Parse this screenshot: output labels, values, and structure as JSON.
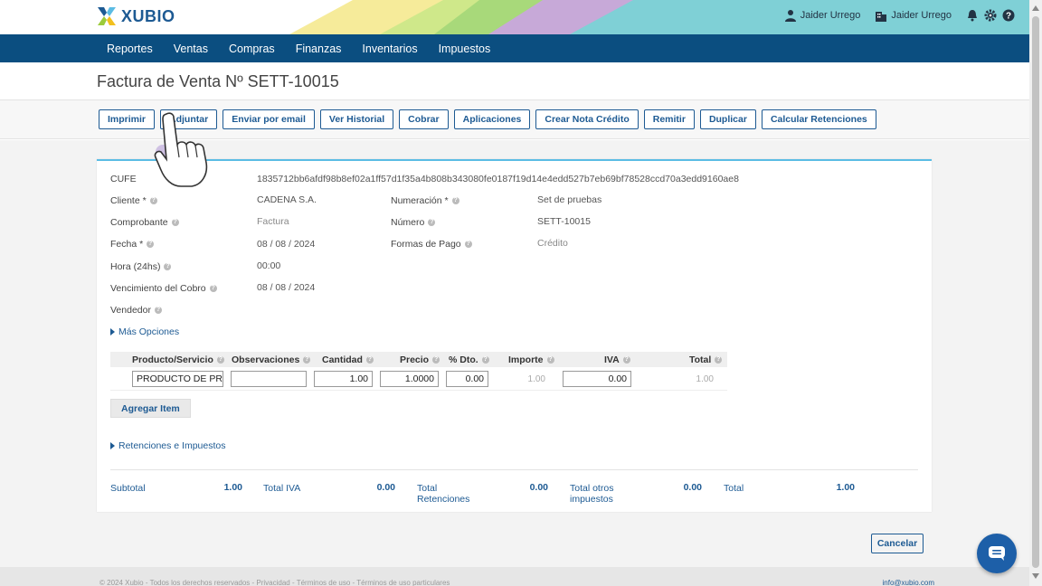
{
  "app": {
    "logo_text": "XUBIO"
  },
  "user": {
    "name": "Jaider Urrego",
    "company": "Jaider Urrego"
  },
  "nav": {
    "items": [
      "Reportes",
      "Ventas",
      "Compras",
      "Finanzas",
      "Inventarios",
      "Impuestos"
    ]
  },
  "page": {
    "title": "Factura de Venta Nº SETT-10015"
  },
  "toolbar": {
    "buttons": [
      "Imprimir",
      "Adjuntar",
      "Enviar por email",
      "Ver Historial",
      "Cobrar",
      "Aplicaciones",
      "Crear Nota Crédito",
      "Remitir",
      "Duplicar",
      "Calcular Retenciones"
    ]
  },
  "form": {
    "cufe_label": "CUFE",
    "cufe_value": "1835712bb6afdf98b8ef02a1ff57d1f35a4b808b343080fe0187f19d14e4edd527b7eb69bf78528ccd70a3edd9160ae8",
    "cliente_label": "Cliente *",
    "cliente_value": "CADENA S.A.",
    "comprobante_label": "Comprobante",
    "comprobante_value": "Factura",
    "fecha_label": "Fecha *",
    "fecha_value": "08 / 08 / 2024",
    "hora_label": "Hora (24hs)",
    "hora_value": "00:00",
    "vencimiento_label": "Vencimiento del Cobro",
    "vencimiento_value": "08 / 08 / 2024",
    "vendedor_label": "Vendedor",
    "numeracion_label": "Numeración *",
    "numeracion_value": "Set de pruebas",
    "numero_label": "Número",
    "numero_value": "SETT-10015",
    "formas_pago_label": "Formas de Pago",
    "formas_pago_value": "Crédito",
    "mas_opciones": "Más Opciones"
  },
  "items_table": {
    "headers": [
      "Producto/Servicio",
      "Observaciones",
      "Cantidad",
      "Precio",
      "% Dto.",
      "Importe",
      "IVA",
      "Total"
    ],
    "row": {
      "producto": "PRODUCTO DE PRU...",
      "observaciones": "",
      "cantidad": "1.00",
      "precio": "1.0000",
      "dto": "0.00",
      "importe": "1.00",
      "iva": "0.00",
      "total": "1.00"
    },
    "add_label": "Agregar Item"
  },
  "retenciones_label": "Retenciones e Impuestos",
  "totals": {
    "subtotal_label": "Subtotal",
    "subtotal_value": "1.00",
    "total_iva_label": "Total IVA",
    "total_iva_value": "0.00",
    "total_ret_label_1": "Total",
    "total_ret_label_2": "Retenciones",
    "total_ret_value": "0.00",
    "total_otros_label_1": "Total otros",
    "total_otros_label_2": "impuestos",
    "total_otros_value": "0.00",
    "total_label": "Total",
    "total_value": "1.00"
  },
  "cancel_label": "Cancelar",
  "footer": {
    "left": "© 2024 Xubio - Todos los derechos reservados - Privacidad - Términos de uso - Términos de uso particulares",
    "right": "info@xubio.com"
  },
  "icons": [
    "user-icon",
    "building-icon",
    "bell-icon",
    "gear-icon",
    "help-icon",
    "chat-icon"
  ],
  "colors": {
    "nav_bg": "#0b4e80",
    "accent": "#1d5a93",
    "panel_top": "#5bbce4"
  }
}
